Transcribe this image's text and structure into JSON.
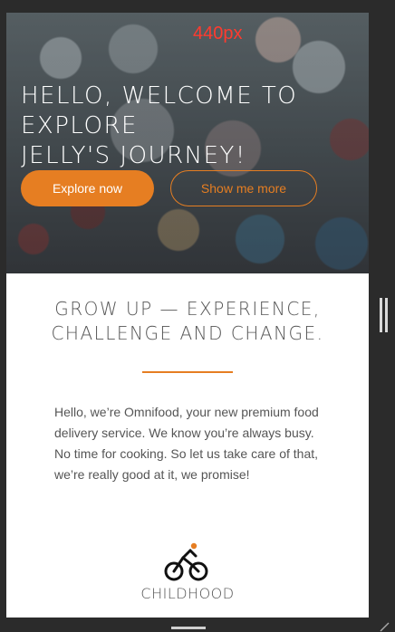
{
  "overlay": {
    "size_label": "440px"
  },
  "hero": {
    "title_lines": [
      "HELLO, WELCOME TO",
      "EXPLORE",
      "JELLY'S JOURNEY!"
    ],
    "primary_button": "Explore now",
    "secondary_button": "Show me more"
  },
  "features_section": {
    "title_lines": [
      "GROW UP — EXPERIENCE,",
      "CHALLENGE AND CHANGE."
    ],
    "intro": "Hello, we’re Omnifood, your new premium food delivery service. We know you’re always busy. No time for cooking. So let us take care of that, we’re really good at it, we promise!",
    "feature": {
      "label": "CHILDHOOD",
      "icon": "bicycle-icon"
    }
  },
  "colors": {
    "accent": "#e67e22",
    "text": "#555555",
    "background": "#2b2b2b"
  }
}
